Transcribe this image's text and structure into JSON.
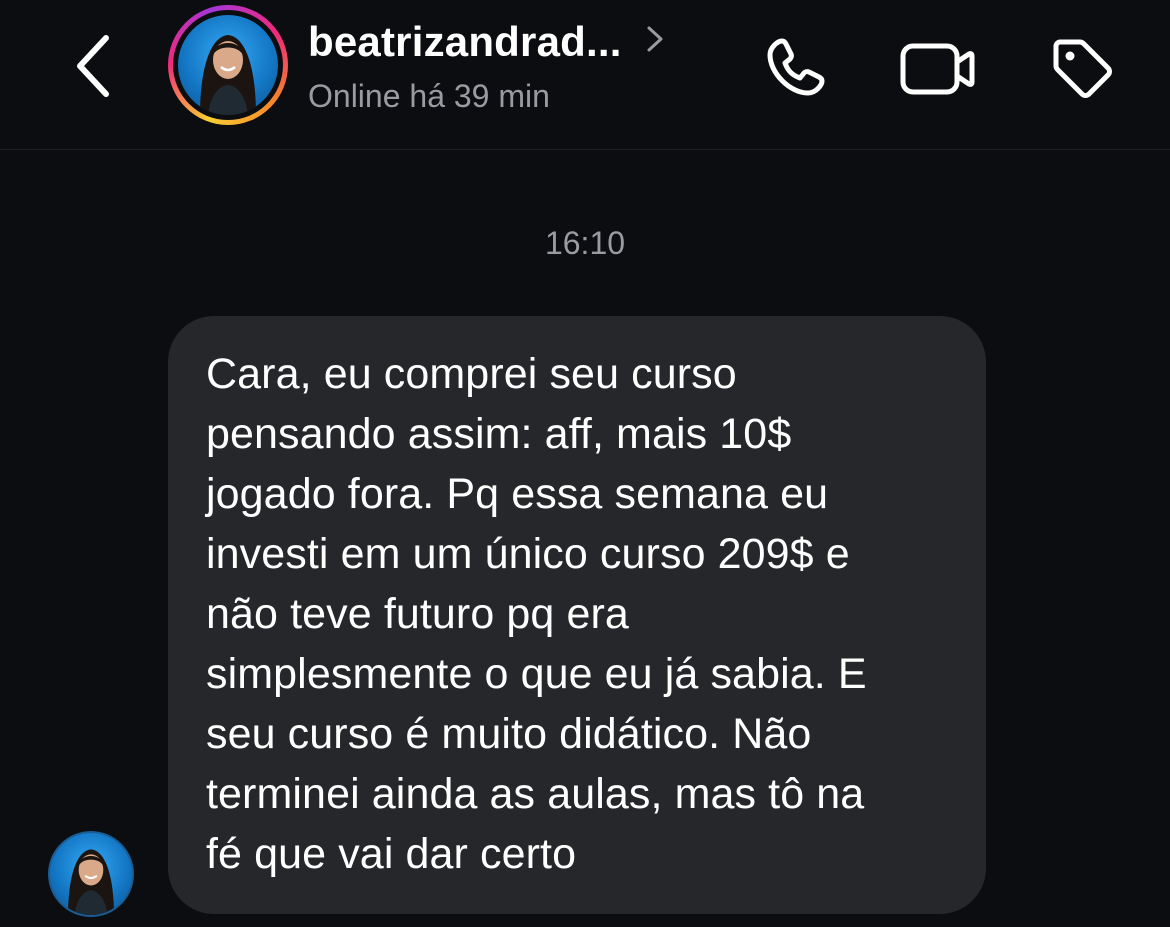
{
  "header": {
    "back_icon": "chevron-left-icon",
    "username": "beatrizandrad...",
    "status": "Online há 39 min",
    "actions": [
      {
        "name": "phone-icon"
      },
      {
        "name": "video-camera-icon"
      },
      {
        "name": "tag-icon"
      }
    ]
  },
  "conversation": {
    "timestamp": "16:10",
    "messages": [
      {
        "sender": "beatrizandrad...",
        "text": "Cara, eu comprei seu curso\npensando assim: aff, mais 10$\njogado fora. Pq essa semana eu\ninvesti em um único curso 209$ e\nnão teve futuro pq era\nsimplesmente o que eu já sabia. E\nseu curso é muito didático. Não\nterminei ainda as aulas, mas tô na\nfé que vai dar certo"
      }
    ]
  },
  "colors": {
    "background": "#0c0d10",
    "bubble": "#26272b",
    "secondary_text": "#9a9ba1",
    "avatar_blue": "#1478c6"
  }
}
